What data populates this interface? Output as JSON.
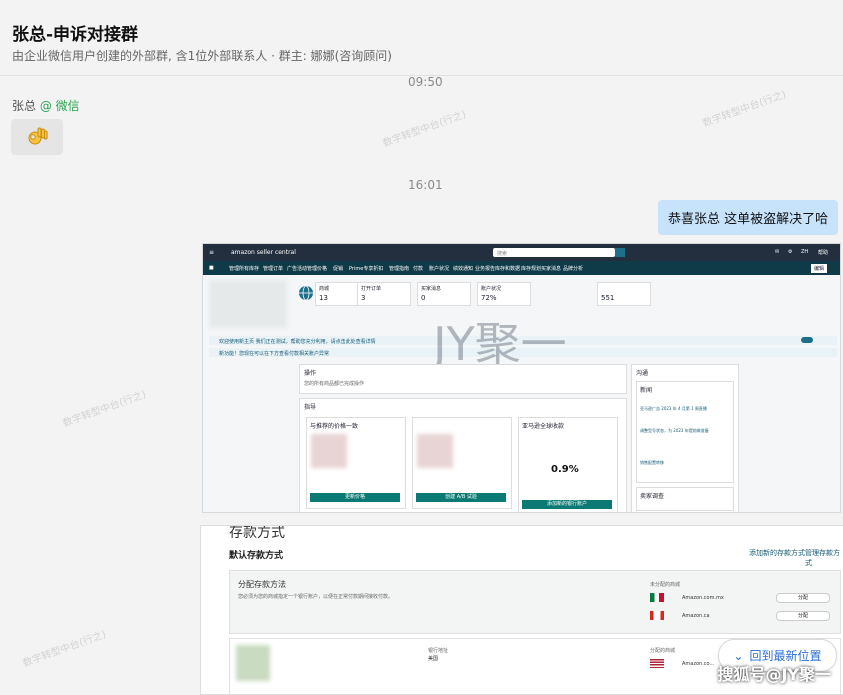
{
  "chat": {
    "title": "张总-申诉对接群",
    "subtitle": "由企业微信用户创建的外部群, 含1位外部联系人 · 群主: 娜娜(咨询顾问)",
    "time1": "09:50",
    "sender_name": "张总",
    "sender_org": "@ 微信",
    "time2": "16:01",
    "my_message": "恭喜张总 这单被盗解决了哈",
    "jump_button": "回到最新位置",
    "source_watermark": "搜狐号@JY聚一"
  },
  "screenshot1": {
    "brand": "amazon seller central",
    "search_placeholder": "搜索",
    "lang": "ZH",
    "help": "帮助",
    "nav": [
      "管理所有库存",
      "管理订单",
      "广告活动管理",
      "价格",
      "促销",
      "Prime专享折扣",
      "管理指南",
      "付款",
      "账户状况",
      "绩效通知",
      "业务报告",
      "库存和数据",
      "库存规划",
      "买家消息",
      "品牌分析"
    ],
    "edit": "编辑",
    "stats": [
      {
        "label": "商城",
        "value": "13"
      },
      {
        "label": "打开订单",
        "value": "3"
      },
      {
        "label": "买家消息",
        "value": "0"
      },
      {
        "label": "账户状况",
        "value": "72%"
      },
      {
        "label": "",
        "value": "551"
      }
    ],
    "alert1": "欢迎使用新主页 我们正在测试，帮助您充分利用，请点击此处查看详情",
    "alert2": "新功能！您现在可以在下方查看付款相关账户异常",
    "watermark_logo": "JY聚一",
    "ops_title": "操作",
    "ops_text": "您的所有商品都已完成操作",
    "follow_title": "指导",
    "card1_title": "与推荐的价格一致",
    "card1_btn": "更新价格",
    "card2_btn": "创建 A/B 试验",
    "card3_title": "亚马逊全球收款",
    "card3_value": "0.9%",
    "card3_btn": "添加新的银行账户",
    "more": "更多",
    "news_title": "新闻",
    "news1": "亚马逊广告 2023 年 4 月第 1 周直播",
    "news2": "调整型号状态，为 2023 年提前做准备",
    "news3": "销售配置转移",
    "side_title": "沟通",
    "buyer_title": "卖家调查"
  },
  "screenshot2": {
    "header_partial": "存款方式",
    "section_title": "默认存款方式",
    "link1": "添加新的存款方式",
    "link2": "管理存款方式",
    "assign_title": "分配存款方法",
    "assign_desc": "您必须为您的商城指定一个银行账户，以便在正常付款期间接收付款。",
    "unassigned": "未分配的商城",
    "market1": "Amazon.com.mx",
    "market2": "Amazon.ca",
    "assign_btn": "分配",
    "bank_location_label": "银行地址",
    "bank_location": "美国",
    "assigned": "分配的商城",
    "market3": "Amazon.co..."
  },
  "colors": {
    "amazon_dark": "#232f3e",
    "amazon_nav": "#0f3a47",
    "bubble_mine": "#c7e3fb",
    "teal_btn": "#0b7a74",
    "link": "#2a6fd6",
    "wechat_green": "#2aa44f"
  }
}
